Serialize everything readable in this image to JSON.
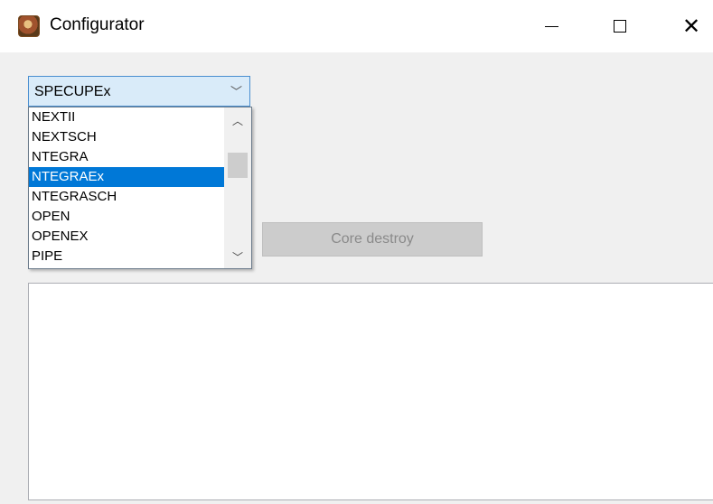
{
  "window": {
    "title": "Configurator",
    "icon": "app-icon",
    "controls": {
      "minimize": "minimize-icon",
      "maximize": "maximize-icon",
      "close": "close-icon"
    }
  },
  "combo": {
    "selected_value": "SPECUPEx",
    "arrow_icon": "chevron-down-icon"
  },
  "dropdown": {
    "items": [
      {
        "label": "NEXTII",
        "selected": false
      },
      {
        "label": "NEXTSCH",
        "selected": false
      },
      {
        "label": "NTEGRA",
        "selected": false
      },
      {
        "label": "NTEGRAEx",
        "selected": true
      },
      {
        "label": "NTEGRASCH",
        "selected": false
      },
      {
        "label": "OPEN",
        "selected": false
      },
      {
        "label": "OPENEX",
        "selected": false
      },
      {
        "label": "PIPE",
        "selected": false
      }
    ],
    "highlight_color": "#0078d7"
  },
  "buttons": {
    "core_destroy": "Core destroy"
  },
  "output": {
    "text": ""
  }
}
